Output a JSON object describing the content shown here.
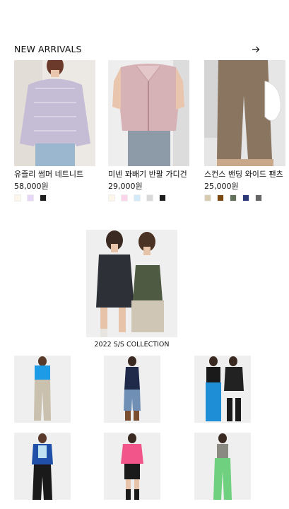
{
  "section": {
    "title": "NEW ARRIVALS"
  },
  "products": [
    {
      "name": "유즐리 썸머 네트니트",
      "price": "58,000원",
      "swatches": [
        "#fdf6ea",
        "#e7d6f5",
        "#1e1e1e"
      ],
      "bg": "#eae6e4",
      "garment": "#c9c2d8"
    },
    {
      "name": "미넨 꽈배기 반팔 가디건",
      "price": "29,000원",
      "swatches": [
        "#fdf6ea",
        "#f9d5ec",
        "#d3eaf9",
        "#d9d9d9",
        "#1e1e1e"
      ],
      "bg": "#eeeeee",
      "garment": "#d8b4b8"
    },
    {
      "name": "스컨스 밴딩 와이드 팬츠",
      "price": "25,000원",
      "swatches": [
        "#d8ccb0",
        "#7a4a12",
        "#62705a",
        "#2d3a7a",
        "#666666"
      ],
      "bg": "#e7e7e7",
      "garment": "#8a7560"
    }
  ],
  "feature": {
    "caption": "2022 S/S COLLECTION"
  },
  "grid": [
    {
      "top": "#1e9be6",
      "bottom": "#c9c0ad"
    },
    {
      "top": "#1f2a4a",
      "bottom": "#6f8fb5"
    },
    {
      "top": "#1a1a1a",
      "bottom": "#1e8fd6"
    },
    {
      "top": "#1f4fa8",
      "bottom": "#1a1a1a"
    },
    {
      "top": "#f2558a",
      "bottom": "#1a1a1a"
    },
    {
      "top": "#8a8a82",
      "bottom": "#6fd080"
    }
  ]
}
